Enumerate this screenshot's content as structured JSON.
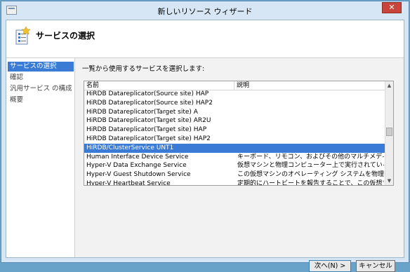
{
  "window": {
    "title": "新しいリソース ウィザード"
  },
  "header": {
    "title": "サービスの選択"
  },
  "nav": {
    "items": [
      "サービスの選択",
      "確認",
      "汎用サービス の構成",
      "概要"
    ]
  },
  "main": {
    "instruction": "一覧から使用するサービスを選択します:"
  },
  "list": {
    "columns": [
      "名前",
      "説明"
    ],
    "rows": [
      {
        "name": "HiRDB Datareplicator(Source site) HAP",
        "desc": ""
      },
      {
        "name": "HiRDB Datareplicator(Source site) HAP2",
        "desc": ""
      },
      {
        "name": "HiRDB Datareplicator(Target site) A",
        "desc": ""
      },
      {
        "name": "HiRDB Datareplicator(Target site) AR2U",
        "desc": ""
      },
      {
        "name": "HiRDB Datareplicator(Target site) HAP",
        "desc": ""
      },
      {
        "name": "HiRDB Datareplicator(Target site) HAP2",
        "desc": ""
      },
      {
        "name": "HiRDB/ClusterService UNT1",
        "desc": ""
      },
      {
        "name": "Human Interface Device Service",
        "desc": "キーボード、リモコン、およびその他のマルチメディア デバ..."
      },
      {
        "name": "Hyper-V Data Exchange Service",
        "desc": "仮想マシンと物理コンピューター上で実行されているオ..."
      },
      {
        "name": "Hyper-V Guest Shutdown Service",
        "desc": "この仮想マシンのオペレーティング システムを物理コンピ..."
      },
      {
        "name": "Hyper-V Heartbeat Service",
        "desc": "定期的にハートビートを報告することで、この仮想マシン..."
      }
    ],
    "selected_index": 6
  },
  "buttons": {
    "next": "次へ(N) >",
    "cancel": "キャンセル"
  },
  "close_glyph": "✕"
}
